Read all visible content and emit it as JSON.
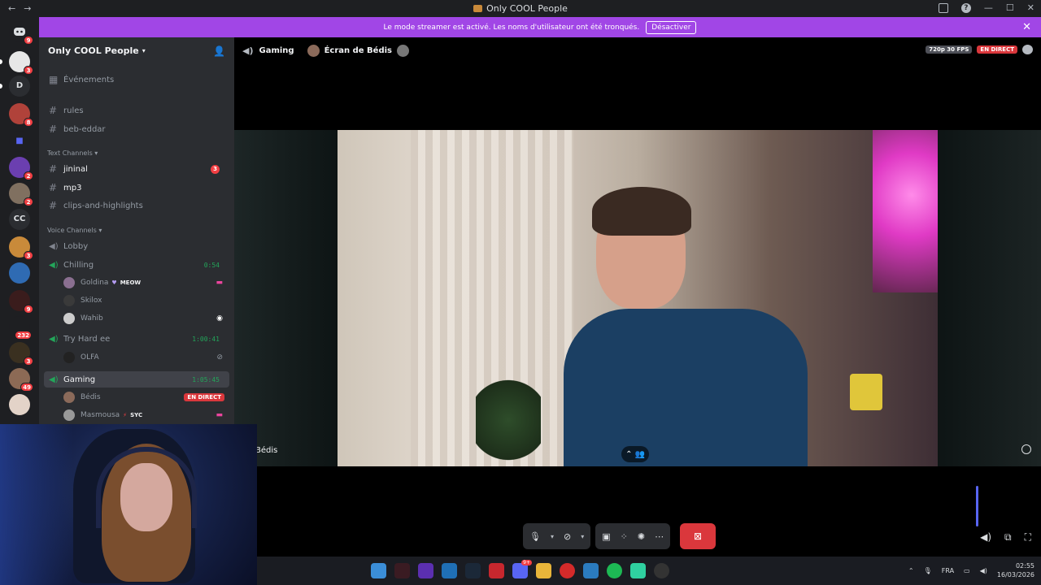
{
  "window": {
    "title": "Only COOL People"
  },
  "banner": {
    "message": "Le mode streamer est activé. Les noms d'utilisateur ont été tronqués.",
    "button": "Désactiver"
  },
  "server": {
    "name": "Only COOL People"
  },
  "channels": {
    "events": "Événements",
    "top": [
      "rules",
      "beb-eddar"
    ],
    "text_category": "Text Channels",
    "text": [
      {
        "name": "jininal",
        "unread": true,
        "count": "3"
      },
      {
        "name": "mp3",
        "unread": true
      },
      {
        "name": "clips-and-highlights",
        "unread": false
      }
    ],
    "voice_category": "Voice Channels",
    "voice": [
      {
        "name": "Lobby",
        "timer": ""
      },
      {
        "name": "Chilling",
        "timer": "0:54"
      },
      {
        "name": "Try Hard ee",
        "timer": "1:00:41"
      },
      {
        "name": "Gaming",
        "timer": "1:05:45"
      }
    ],
    "chilling_members": [
      {
        "name": "Goldina",
        "tag": "MEOW"
      },
      {
        "name": "Skilox",
        "tag": ""
      },
      {
        "name": "Wahib",
        "tag": ""
      }
    ],
    "tryhard_members": [
      {
        "name": "OLFA"
      }
    ],
    "gaming_members": [
      {
        "name": "Bédis",
        "live": "EN DIRECT"
      },
      {
        "name": "Masmousa",
        "tag": "SYC"
      }
    ]
  },
  "guilds": {
    "letters": [
      "D",
      "CC"
    ],
    "badges": [
      "9",
      "3",
      "8",
      "2",
      "2",
      "3",
      "9",
      "232",
      "3",
      "49"
    ]
  },
  "stage": {
    "channel": "Gaming",
    "screen_title": "Écran de Bédis",
    "quality": "720p 30 FPS",
    "live": "EN DIRECT",
    "streamer_label": "Bédis"
  },
  "taskbar": {
    "lang": "FRA",
    "time": "02:55",
    "date": "16/03/2026",
    "discord_badge": "9+"
  },
  "colors": {
    "accent": "#a146e6",
    "live": "#da373c",
    "voice": "#23a55a",
    "blurple": "#5865f2"
  }
}
